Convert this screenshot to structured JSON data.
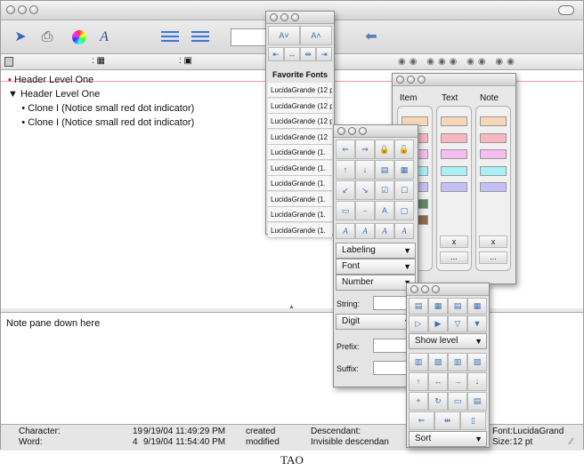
{
  "toolbar": {
    "text_style_glyph": "A",
    "icons": [
      "pointer-icon",
      "print-icon",
      "color-wheel-icon",
      "text-style-icon",
      "indent-icon",
      "outdent-icon",
      "zoom-icon"
    ]
  },
  "outline": {
    "rows": [
      {
        "marker": "▪",
        "text": "Header Level One"
      },
      {
        "marker": "▼",
        "text": "Header Level One"
      },
      {
        "marker": "•",
        "text": "Clone I (Notice small red dot indicator)"
      },
      {
        "marker": "•",
        "text": "Clone I (Notice small red dot indicator)"
      }
    ]
  },
  "note": {
    "text": "Note pane down here"
  },
  "status": {
    "character_label": "Character:",
    "character_value": "19",
    "character_date": "9/19/04 11:49:29 PM",
    "character_action": "created",
    "word_label": "Word:",
    "word_value": "4",
    "word_date": "9/19/04 11:54:40 PM",
    "word_action": "modified",
    "descendant_label": "Descendant:",
    "invisible_label": "Invisible descendan",
    "font_label": "Font:",
    "font_value": "LucidaGrand",
    "size_label": "Size:",
    "size_value": "12 pt"
  },
  "font_palette": {
    "heading": "Favorite Fonts",
    "fonts": [
      "LucidaGrande (12 pt",
      "LucidaGrande (12 pt",
      "LucidaGrande (12 pt",
      "LucidaGrande (12",
      "LucidaGrande (1.",
      "LucidaGrande (1.",
      "LucidaGrande (1.",
      "LucidaGrande (1.",
      "LucidaGrande (1.",
      "LucidaGrande (1."
    ]
  },
  "color_palette": {
    "columns": [
      "Item",
      "Text",
      "Note"
    ],
    "colors": [
      "#f7d6b8",
      "#f7b6c0",
      "#f4bcef",
      "#a8f0f4",
      "#c4c0f6",
      "#5f8a66",
      "#8f6a4f"
    ],
    "clear_label": "x",
    "more_label": "..."
  },
  "numbering_palette": {
    "labeling": "Labeling",
    "font": "Font",
    "number": "Number",
    "string_label": "String:",
    "digit": "Digit",
    "prefix_label": "Prefix:",
    "suffix_label": "Suffix:",
    "italic_glyphs": [
      "A",
      "A",
      "A",
      "A"
    ]
  },
  "level_palette": {
    "show_level": "Show level",
    "sort": "Sort"
  },
  "caption": "TAO"
}
